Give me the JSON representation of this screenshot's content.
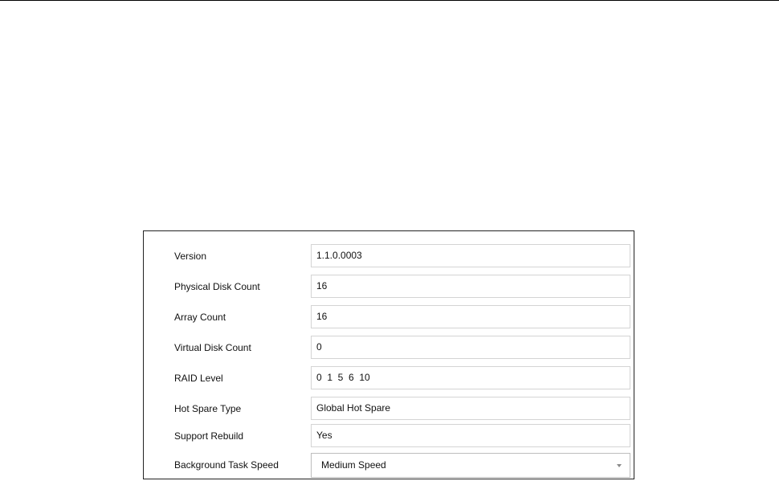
{
  "disk_info": {
    "version": {
      "label": "Version",
      "value": "1.1.0.0003"
    },
    "physical_disk_count": {
      "label": "Physical Disk Count",
      "value": "16"
    },
    "array_count": {
      "label": "Array Count",
      "value": "16"
    },
    "virtual_disk_count": {
      "label": "Virtual Disk Count",
      "value": "0"
    },
    "raid_level": {
      "label": "RAID Level",
      "value": "0  1  5  6  10"
    },
    "hot_spare_type": {
      "label": "Hot Spare Type",
      "value": "Global Hot Spare"
    },
    "support_rebuild": {
      "label": "Support Rebuild",
      "value": "Yes"
    },
    "background_task_speed": {
      "label": "Background Task Speed",
      "selected": "Medium Speed",
      "icon": "chevron-down-icon"
    }
  }
}
